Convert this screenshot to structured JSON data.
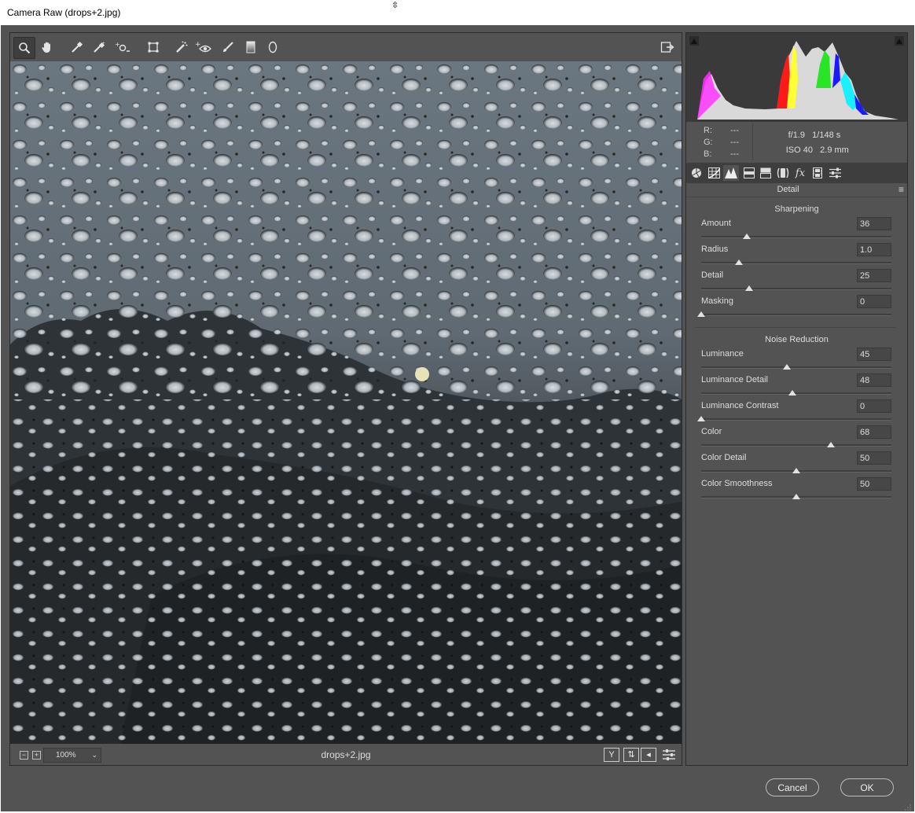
{
  "window": {
    "title": "Camera Raw (drops+2.jpg)"
  },
  "toolbar": {
    "tools": [
      "zoom-icon",
      "hand-icon",
      "white-balance-icon",
      "color-sampler-icon",
      "targeted-adjustment-icon",
      "transform-icon",
      "spot-removal-icon",
      "red-eye-icon",
      "adjustment-brush-icon",
      "graduated-filter-icon",
      "radial-filter-icon"
    ],
    "open_preferences_icon": "open-image-icon"
  },
  "status": {
    "zoom": "100%",
    "filename": "drops+2.jpg",
    "zoom_out": "−",
    "zoom_in": "+",
    "before_after_label": "Y"
  },
  "histogram": {
    "colors": {
      "red": "#ff1a1a",
      "green": "#26e626",
      "blue": "#1a1aff",
      "cyan": "#19f0ff",
      "yellow": "#ffff33",
      "magenta": "#ff33ff",
      "gray": "#d9d9d9"
    }
  },
  "readout": {
    "r_label": "R:",
    "r_value": "---",
    "g_label": "G:",
    "g_value": "---",
    "b_label": "B:",
    "b_value": "---",
    "aperture": "f/1.9",
    "shutter": "1/148 s",
    "iso": "ISO 40",
    "focal": "2.9 mm"
  },
  "panel": {
    "tabs": [
      "basic-icon",
      "tone-curve-icon",
      "detail-icon",
      "hsl-icon",
      "split-toning-icon",
      "lens-corrections-icon",
      "effects-icon",
      "camera-calibration-icon",
      "presets-icon"
    ],
    "active_tab": 2,
    "title": "Detail",
    "sharpening": {
      "heading": "Sharpening",
      "sliders": [
        {
          "label": "Amount",
          "value": "36",
          "pos": 0.24
        },
        {
          "label": "Radius",
          "value": "1.0",
          "pos": 0.2
        },
        {
          "label": "Detail",
          "value": "25",
          "pos": 0.25
        },
        {
          "label": "Masking",
          "value": "0",
          "pos": 0.0
        }
      ]
    },
    "noise_reduction": {
      "heading": "Noise Reduction",
      "sliders": [
        {
          "label": "Luminance",
          "value": "45",
          "pos": 0.45
        },
        {
          "label": "Luminance Detail",
          "value": "48",
          "pos": 0.48
        },
        {
          "label": "Luminance Contrast",
          "value": "0",
          "pos": 0.0
        },
        {
          "label": "Color",
          "value": "68",
          "pos": 0.68
        },
        {
          "label": "Color Detail",
          "value": "50",
          "pos": 0.5
        },
        {
          "label": "Color Smoothness",
          "value": "50",
          "pos": 0.5
        }
      ]
    }
  },
  "buttons": {
    "cancel": "Cancel",
    "ok": "OK"
  }
}
